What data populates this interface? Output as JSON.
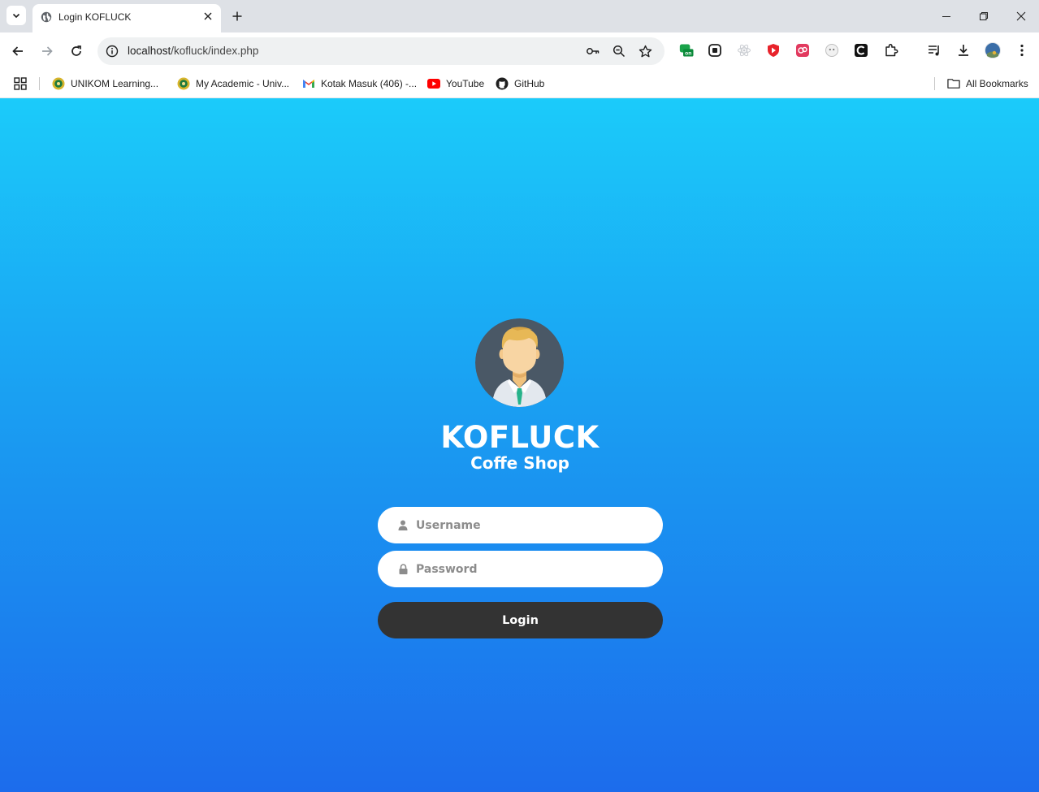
{
  "browser": {
    "tab": {
      "title": "Login KOFLUCK"
    },
    "address": {
      "host": "localhost",
      "path": "/kofluck/index.php"
    },
    "bookmarks": [
      {
        "label": "UNIKOM Learning..."
      },
      {
        "label": "My Academic - Univ..."
      },
      {
        "label": "Kotak Masuk (406) -..."
      },
      {
        "label": "YouTube"
      },
      {
        "label": "GitHub"
      }
    ],
    "all_bookmarks": "All Bookmarks",
    "extension_badge": "on"
  },
  "login": {
    "brand": "KOFLUCK",
    "subtitle": "Coffe Shop",
    "username_placeholder": "Username",
    "password_placeholder": "Password",
    "button_label": "Login"
  },
  "colors": {
    "gradient_top": "#1bcbfa",
    "gradient_bottom": "#1c6cec",
    "button": "#333333",
    "avatar_bg": "#4a5866"
  }
}
